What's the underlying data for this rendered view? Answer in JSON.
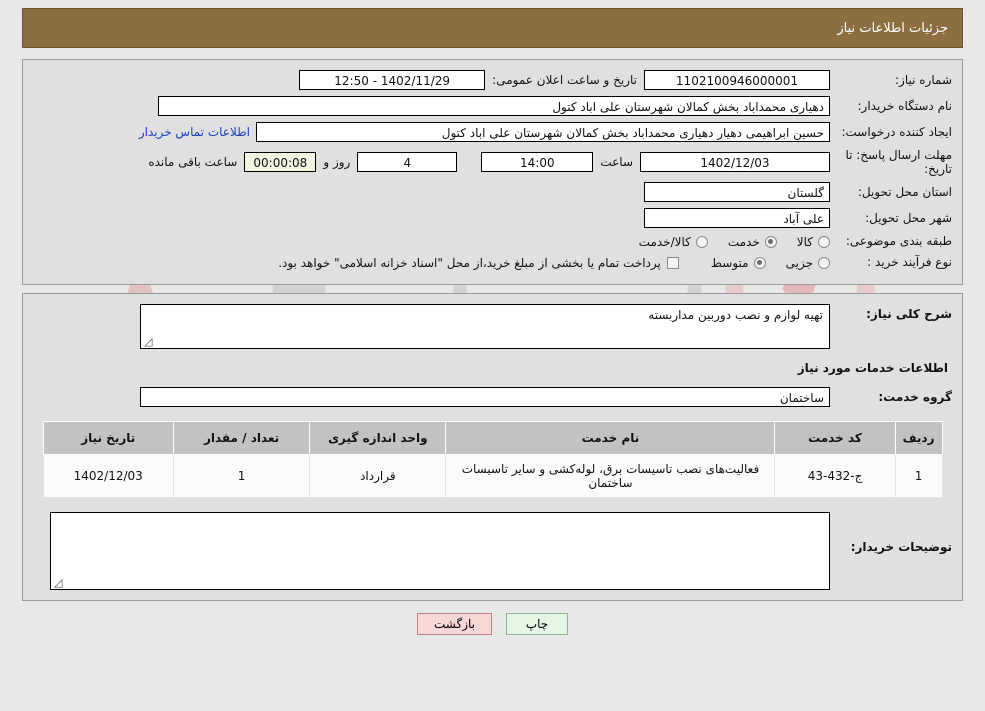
{
  "header": {
    "title": "جزئیات اطلاعات نیاز",
    "bar_color": "#8d6e41"
  },
  "watermark": {
    "text_left": "Ana",
    "text_right": "Tender.net"
  },
  "info": {
    "need_no_label": "شماره نیاز:",
    "need_no_value": "1102100946000001",
    "announce_label": "تاریخ و ساعت اعلان عمومی:",
    "announce_value": "1402/11/29 - 12:50",
    "buyer_org_label": "نام دستگاه خریدار:",
    "buyer_org_value": "دهیاری محمداباد بخش کمالان شهرستان علی اباد کتول",
    "creator_label": "ایجاد کننده درخواست:",
    "creator_value": "حسین ابراهیمی دهیار دهیاری محمداباد بخش کمالان شهرستان علی اباد کتول",
    "contact_link": "اطلاعات تماس خریدار",
    "deadline_label": "مهلت ارسال پاسخ: تا تاریخ:",
    "deadline_date": "1402/12/03",
    "hour_label": "ساعت",
    "deadline_hour": "14:00",
    "days_value": "4",
    "days_label": "روز و",
    "timer_value": "00:00:08",
    "remaining_label": "ساعت باقی مانده",
    "province_label": "استان محل تحویل:",
    "province_value": "گلستان",
    "city_label": "شهر محل تحویل:",
    "city_value": "علی آباد",
    "category_label": "طبقه بندی موضوعی:",
    "category_options": [
      {
        "label": "کالا",
        "selected": false
      },
      {
        "label": "خدمت",
        "selected": true
      },
      {
        "label": "کالا/خدمت",
        "selected": false
      }
    ],
    "process_label": "نوع فرآیند خرید :",
    "process_options": [
      {
        "label": "جزیی",
        "selected": false
      },
      {
        "label": "متوسط",
        "selected": true
      }
    ],
    "treasury_note": "پرداخت تمام یا بخشی از مبلغ خرید،از محل \"اسناد خزانه اسلامی\" خواهد بود.",
    "treasury_checked": false
  },
  "details": {
    "general_desc_label": "شرح کلی نیاز:",
    "general_desc_value": "تهیه لوازم و نصب دوربین مداربسته",
    "services_section_title": "اطلاعات خدمات مورد نیاز",
    "service_group_label": "گروه خدمت:",
    "service_group_value": "ساختمان",
    "buyer_comment_label": "توضیحات خریدار:",
    "buyer_comment_value": ""
  },
  "table": {
    "headers": [
      "ردیف",
      "کد خدمت",
      "نام خدمت",
      "واحد اندازه گیری",
      "تعداد / مقدار",
      "تاریخ نیاز"
    ],
    "rows": [
      {
        "row_no": "1",
        "service_code": "ج-432-43",
        "service_name": "فعالیت‌های نصب تاسیسات برق، لوله‌کشی و سایر تاسیسات ساختمان",
        "unit": "قرارداد",
        "quantity": "1",
        "need_date": "1402/12/03"
      }
    ]
  },
  "buttons": {
    "back_label": "بازگشت",
    "print_label": "چاپ"
  }
}
